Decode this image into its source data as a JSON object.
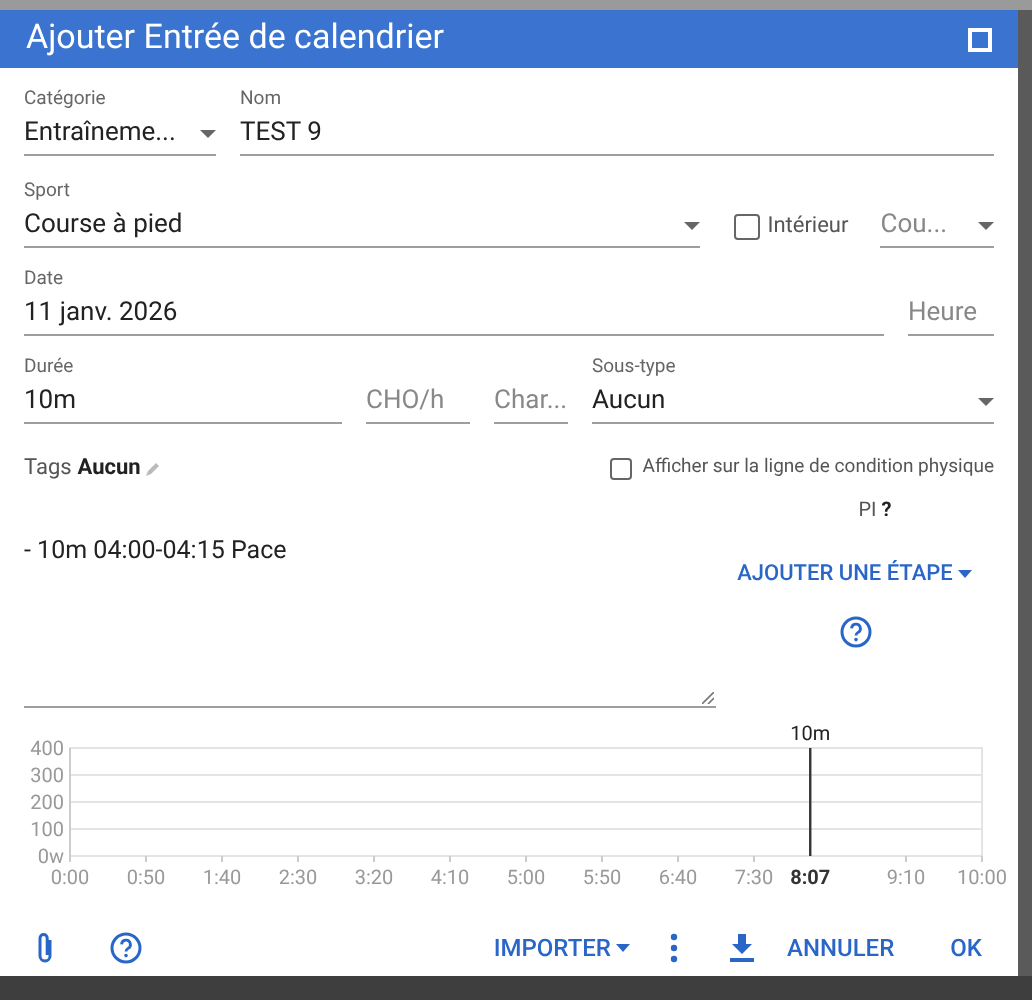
{
  "dialog": {
    "title": "Ajouter Entrée de calendrier"
  },
  "fields_row_1": [
    {
      "kind": "select",
      "label": "Catégorie",
      "value": "Entraîneme..."
    },
    {
      "kind": "text",
      "label": "Nom",
      "value": "TEST 9"
    }
  ],
  "sport": {
    "label": "Sport",
    "value": "Course à pied"
  },
  "indoor": {
    "label": "Intérieur",
    "checked": false
  },
  "sport_subtype": {
    "value": "Cou..."
  },
  "date": {
    "label": "Date",
    "value": "11 janv. 2026"
  },
  "time": {
    "placeholder": "Heure"
  },
  "duration": {
    "label": "Durée",
    "value": "10m"
  },
  "cho": {
    "placeholder": "CHO/h"
  },
  "load": {
    "placeholder": "Char..."
  },
  "subtype": {
    "label": "Sous-type",
    "value": "Aucun"
  },
  "tags": {
    "label": "Tags",
    "value": "Aucun"
  },
  "fitness_line": {
    "label": "Afficher sur la ligne de condition physique",
    "checked": false
  },
  "pi": {
    "label": "PI",
    "value": "?"
  },
  "workout_text": "- 10m 04:00-04:15 Pace",
  "add_step": "AJOUTER UNE ÉTAPE",
  "chart": {
    "chart_data": {
      "type": "line",
      "grid": true,
      "xlim": [
        0,
        600
      ],
      "ylim": [
        0,
        400
      ],
      "yticks": [
        {
          "value": 0,
          "label": "0w"
        },
        {
          "value": 100,
          "label": "100"
        },
        {
          "value": 200,
          "label": "200"
        },
        {
          "value": 300,
          "label": "300"
        },
        {
          "value": 400,
          "label": "400"
        }
      ],
      "xticks": [
        {
          "value": 0,
          "label": "0:00"
        },
        {
          "value": 50,
          "label": "0:50"
        },
        {
          "value": 100,
          "label": "1:40"
        },
        {
          "value": 150,
          "label": "2:30"
        },
        {
          "value": 200,
          "label": "3:20"
        },
        {
          "value": 250,
          "label": "4:10"
        },
        {
          "value": 300,
          "label": "5:00"
        },
        {
          "value": 350,
          "label": "5:50"
        },
        {
          "value": 400,
          "label": "6:40"
        },
        {
          "value": 450,
          "label": "7:30"
        },
        {
          "value": 550,
          "label": "9:10"
        },
        {
          "value": 600,
          "label": "10:00"
        }
      ],
      "ref_lines": [
        {
          "axis": "x",
          "value": 487,
          "label": "10m"
        }
      ],
      "annotations": [
        {
          "x": 487,
          "y": 0,
          "text": "8:07"
        }
      ]
    }
  },
  "footer": {
    "import": "IMPORTER",
    "cancel": "ANNULER",
    "ok": "OK"
  }
}
